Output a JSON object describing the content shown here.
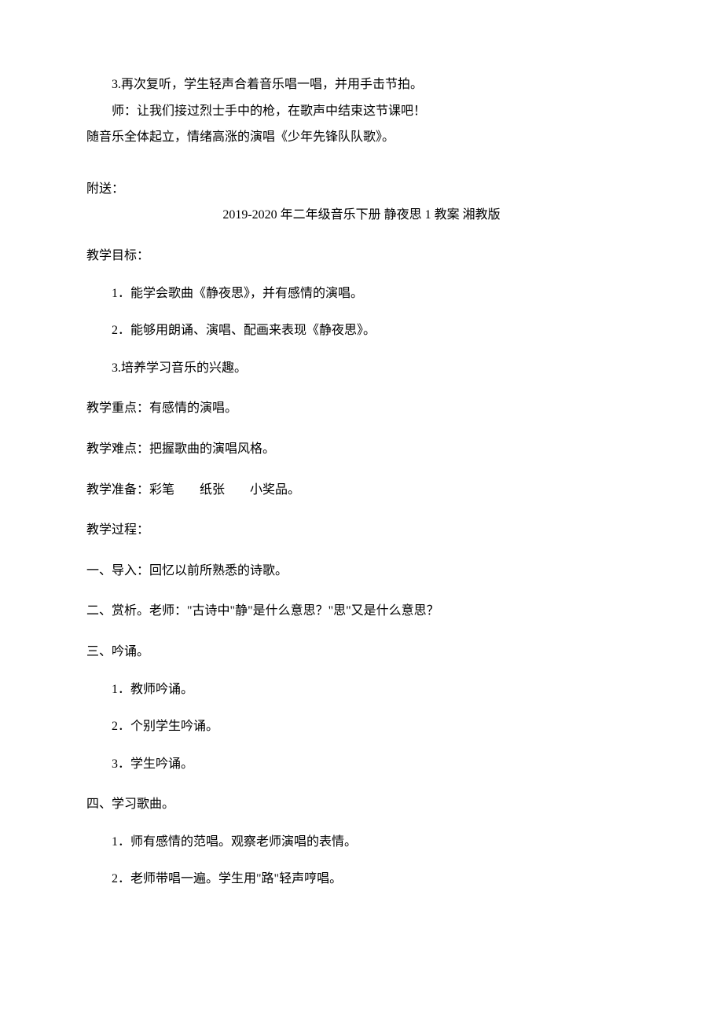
{
  "top": {
    "line1": "3.再次复听，学生轻声合着音乐唱一唱，并用手击节拍。",
    "line2": "师：让我们接过烈士手中的枪，在歌声中结束这节课吧！",
    "line3": "随音乐全体起立，情绪高涨的演唱《少年先锋队队歌》。"
  },
  "attachment_label": "附送：",
  "title": "2019-2020 年二年级音乐下册 静夜思 1 教案 湘教版",
  "objectives_title": "教学目标：",
  "objectives": {
    "item1": "1．能学会歌曲《静夜思》，并有感情的演唱。",
    "item2": "2．能够用朗诵、演唱、配画来表现《静夜思》。",
    "item3": "3.培养学习音乐的兴趣。"
  },
  "focus": "教学重点：有感情的演唱。",
  "difficulty": "教学难点：把握歌曲的演唱风格。",
  "preparation": "教学准备：彩笔　　纸张　　小奖品。",
  "process_title": "教学过程：",
  "step1": "一、导入：回忆以前所熟悉的诗歌。",
  "step2": "二、赏析。老师：\"古诗中\"静\"是什么意思？\"思\"又是什么意思？",
  "step3_title": "三、吟诵。",
  "step3": {
    "item1": "1．教师吟诵。",
    "item2": "2．个别学生吟诵。",
    "item3": "3．学生吟诵。"
  },
  "step4_title": "四、学习歌曲。",
  "step4": {
    "item1": "1．师有感情的范唱。观察老师演唱的表情。",
    "item2": "2．老师带唱一遍。学生用\"路\"轻声哼唱。"
  }
}
